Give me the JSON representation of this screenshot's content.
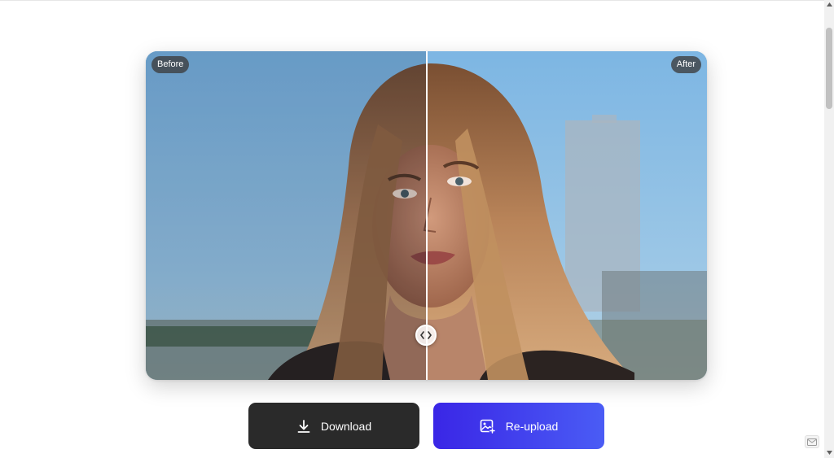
{
  "comparison": {
    "before_label": "Before",
    "after_label": "After"
  },
  "actions": {
    "download_label": "Download",
    "reupload_label": "Re-upload"
  },
  "icons": {
    "download": "download-icon",
    "reupload": "image-plus-icon",
    "handle": "chevron-left-right-icon",
    "widget": "mail-icon"
  },
  "colors": {
    "download_button": "#2a2a2a",
    "reupload_button_start": "#3a26e6",
    "reupload_button_end": "#4a5cf5",
    "badge": "#3c3c3c"
  }
}
